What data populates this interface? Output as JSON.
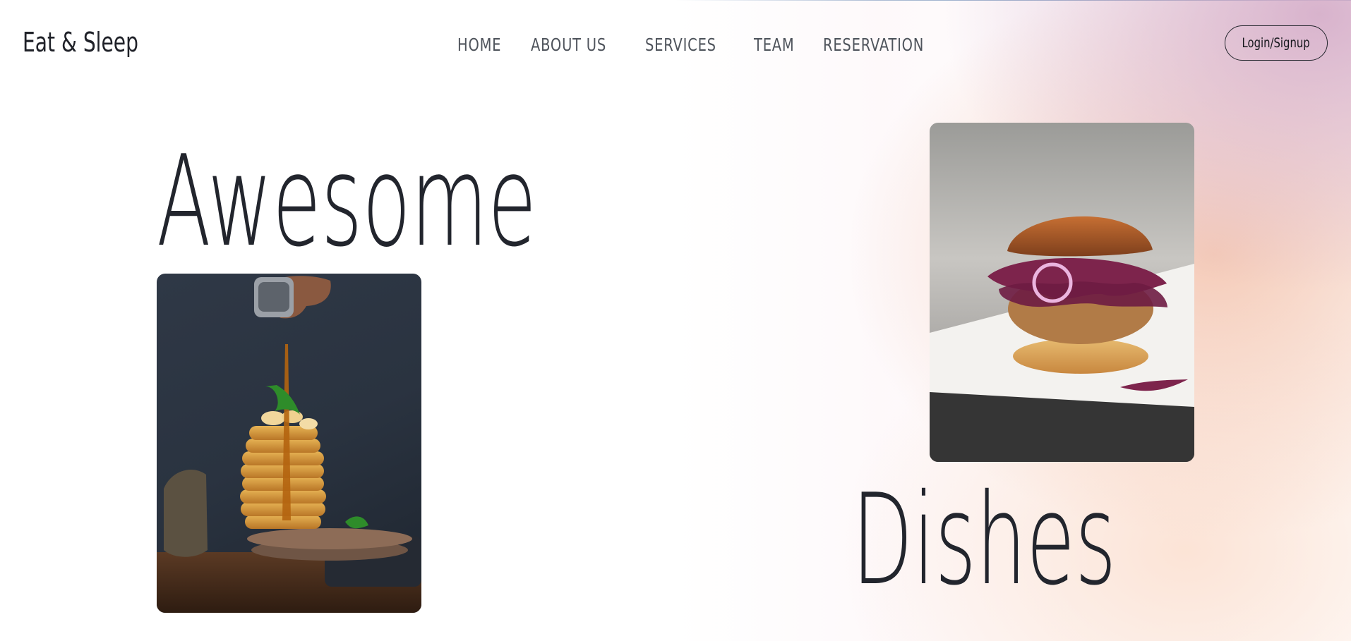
{
  "brand": {
    "name": "Eat & Sleep"
  },
  "nav": {
    "items": [
      {
        "label": "HOME"
      },
      {
        "label": "ABOUT US"
      },
      {
        "label": "SERVICES"
      },
      {
        "label": "TEAM"
      },
      {
        "label": "RESERVATION"
      }
    ],
    "login_label": "Login/Signup"
  },
  "hero": {
    "word_1": "Awesome",
    "word_2": "Dishes",
    "images": [
      {
        "icon": "pancake-stack-photo"
      },
      {
        "icon": "burger-photo"
      }
    ]
  },
  "colors": {
    "text": "#22252d",
    "gradient_pink": "#d6afca",
    "gradient_peach": "#f2bea6",
    "gradient_light": "#fbdfcf"
  }
}
